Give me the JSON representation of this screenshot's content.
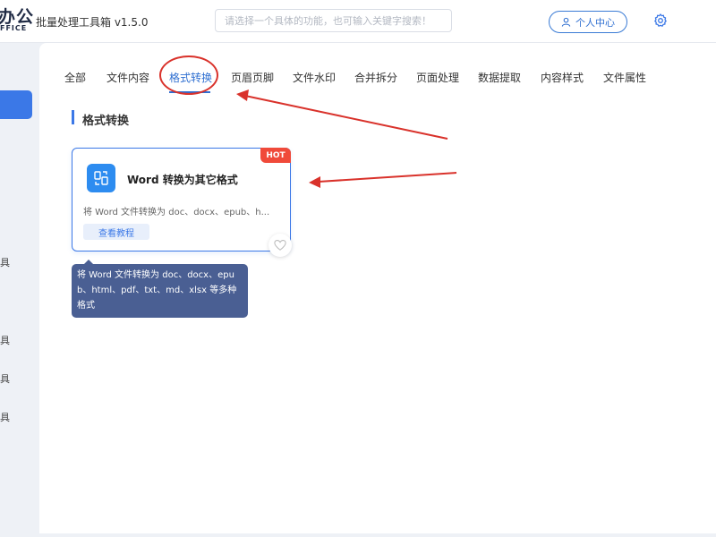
{
  "header": {
    "logo_main": "办公",
    "logo_sub": "FFICE",
    "app_title": "批量处理工具箱 v1.5.0",
    "search_placeholder": "请选择一个具体的功能，也可输入关键字搜索！",
    "user_center_label": "个人中心",
    "user_icon": "user-icon",
    "settings_icon": "gear-icon"
  },
  "sidebar": {
    "items": [
      "具",
      "具",
      "具",
      "具"
    ]
  },
  "tabs": [
    {
      "label": "全部",
      "active": false
    },
    {
      "label": "文件内容",
      "active": false
    },
    {
      "label": "格式转换",
      "active": true
    },
    {
      "label": "页眉页脚",
      "active": false
    },
    {
      "label": "文件水印",
      "active": false
    },
    {
      "label": "合并拆分",
      "active": false
    },
    {
      "label": "页面处理",
      "active": false
    },
    {
      "label": "数据提取",
      "active": false
    },
    {
      "label": "内容样式",
      "active": false
    },
    {
      "label": "文件属性",
      "active": false
    }
  ],
  "section": {
    "title": "格式转换"
  },
  "card": {
    "badge": "HOT",
    "title": "Word 转换为其它格式",
    "description": "将 Word 文件转换为 doc、docx、epub、h...",
    "tutorial_label": "查看教程",
    "icon": "convert-icon",
    "favorite_icon": "heart-icon"
  },
  "tooltip": {
    "line1": "将 Word 文件转换为 doc、docx、epu",
    "line2": "b、html、pdf、txt、md、xlsx 等多种",
    "line3": "格式"
  },
  "colors": {
    "accent": "#3b78e7",
    "annotation": "#d9322b",
    "hot_badge": "#f04a3a",
    "tooltip_bg": "#4a5f93"
  }
}
